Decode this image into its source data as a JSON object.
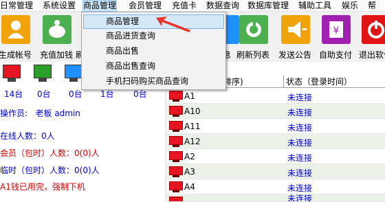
{
  "menu": [
    "日常管理",
    "系统设置",
    "商品管理",
    "会员管理",
    "充值卡",
    "数据查询",
    "数据库管理",
    "辅助工具",
    "娱乐",
    "帮"
  ],
  "toolbar": {
    "buttons": [
      {
        "label": "生成帐号",
        "icon": "user-icon",
        "color": "#f0a30a"
      },
      {
        "label": "充值加钱",
        "icon": "piggy-bank-icon",
        "color": "#4caf50"
      },
      {
        "label": "刷",
        "icon": "hidden-icon",
        "color": "#1e90ff"
      },
      {
        "label": "息",
        "icon": "hidden-icon",
        "color": "#1e90ff"
      },
      {
        "label": "刷新列表",
        "icon": "refresh-icon",
        "color": "#4caf50"
      },
      {
        "label": "发送公告",
        "icon": "megaphone-icon",
        "color": "#f0a30a"
      },
      {
        "label": "自助支付",
        "icon": "yen-icon",
        "color": "#a020b0"
      },
      {
        "label": "退出软件",
        "icon": "power-icon",
        "color": "#e01414"
      }
    ]
  },
  "left": {
    "monitors": [
      {
        "count": "14台",
        "color": "#e81323"
      },
      {
        "count": "0台",
        "color": "#2aa02a"
      },
      {
        "count": "0台",
        "color": "#1e90ff"
      },
      {
        "count": "1台",
        "color": "#1e90ff"
      },
      {
        "count": "0台",
        "color": "#1e90ff"
      }
    ],
    "operator_label": "操作员:",
    "operator_value": "老板 admin",
    "online": "在线人数：0人",
    "member": "会员（包时）人数：0(0)人",
    "temp": "临时（包时）人数：0(0)人",
    "notice": "A1钱已用完，强制下机"
  },
  "table": {
    "col_name": "排序)",
    "col_status": "状态（登录时间）",
    "rows": [
      {
        "name": "A1",
        "status": "未连接"
      },
      {
        "name": "A10",
        "status": "未连接"
      },
      {
        "name": "A11",
        "status": "未连接"
      },
      {
        "name": "A12",
        "status": "未连接"
      },
      {
        "name": "A2",
        "status": "未连接"
      },
      {
        "name": "A3",
        "status": "未连接"
      },
      {
        "name": "A4",
        "status": "未连接"
      },
      {
        "name": "",
        "status": "未连接"
      }
    ]
  },
  "dropdown": [
    "商品管理",
    "商品进货查询",
    "商品出售",
    "商品出售查询",
    "手机扫码购买商品查询"
  ]
}
